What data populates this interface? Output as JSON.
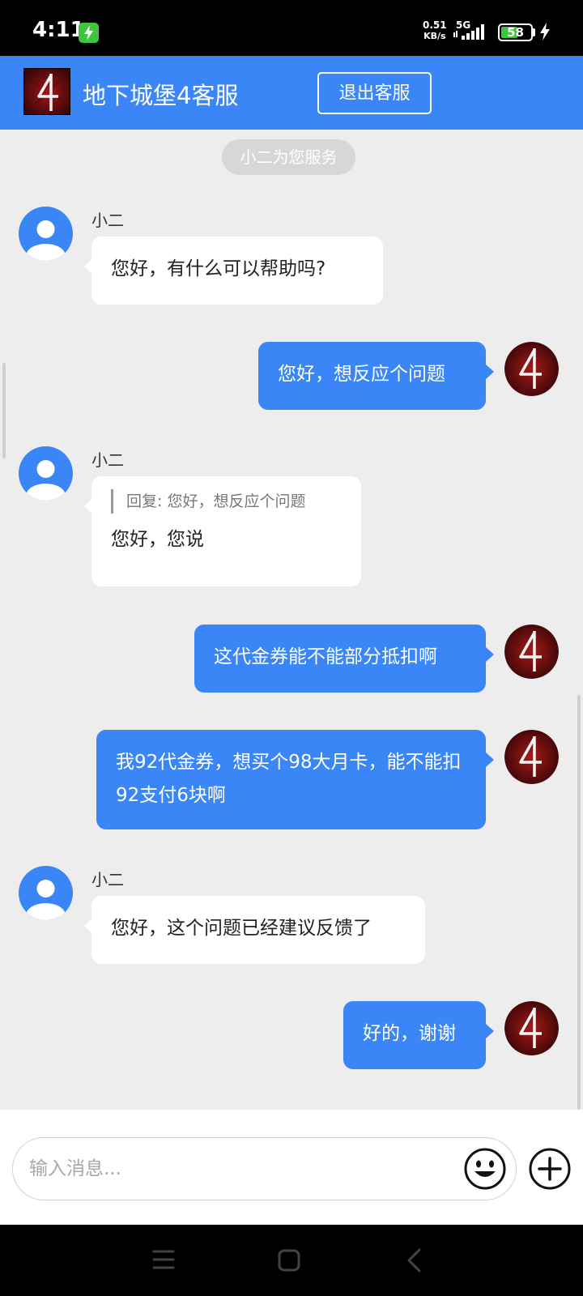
{
  "status_bar": {
    "time": "4:11",
    "net_speed_value": "0.51",
    "net_speed_unit": "KB/s",
    "network_type": "5G",
    "battery_level": "58",
    "battery_fraction": 0.58,
    "icons": [
      "charging-badge-icon",
      "signal-icon",
      "battery-icon",
      "bolt-icon"
    ]
  },
  "header": {
    "title": "地下城堡4客服",
    "exit_button": "退出客服",
    "logo_icon": "game-logo-icon"
  },
  "chat": {
    "service_notice": "小二为您服务",
    "messages": [
      {
        "from": "agent",
        "sender": "小二",
        "text": "您好，有什么可以帮助吗?"
      },
      {
        "from": "user",
        "text": "您好，想反应个问题"
      },
      {
        "from": "agent",
        "sender": "小二",
        "reply_quote": "回复: 您好，想反应个问题",
        "text": "您好，您说"
      },
      {
        "from": "user",
        "text": "这代金券能不能部分抵扣啊"
      },
      {
        "from": "user",
        "text": "我92代金券，想买个98大月卡，能不能扣92支付6块啊"
      },
      {
        "from": "agent",
        "sender": "小二",
        "text": "您好，这个问题已经建议反馈了"
      },
      {
        "from": "user",
        "text": "好的，谢谢"
      }
    ]
  },
  "input": {
    "placeholder": "输入消息...",
    "emoji_icon": "emoji-icon",
    "plus_icon": "plus-icon"
  },
  "nav_bar": {
    "icons": [
      "menu-icon",
      "home-square-icon",
      "back-chevron-icon"
    ]
  },
  "colors": {
    "accent": "#3a86f7",
    "background": "#ededed",
    "bubble_in": "#ffffff"
  }
}
